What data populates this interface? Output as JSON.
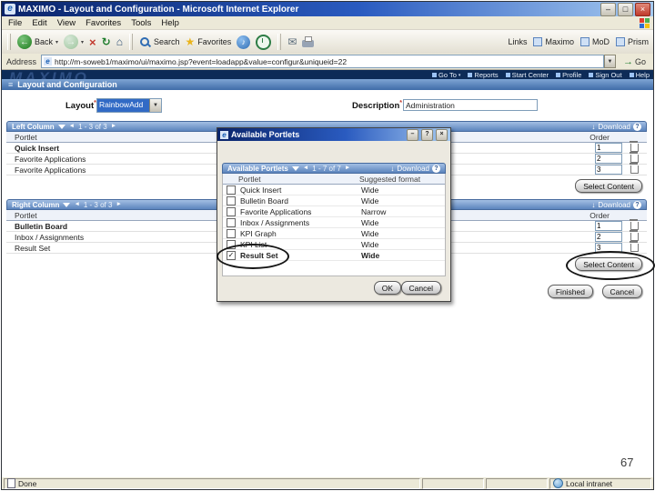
{
  "slide": {
    "number": "67"
  },
  "icons": {
    "ie": "e",
    "minimize": "–",
    "maximize": "□",
    "close": "×",
    "back": "←",
    "forward": "→",
    "stop": "×",
    "refresh": "↻",
    "home": "⌂",
    "favorites_star": "★",
    "media_note": "♪",
    "mail": "✉",
    "dropdown": "▾",
    "select_arrow": "▼",
    "go_arrow": "→",
    "prev": "◄",
    "next": "►",
    "download": "↓",
    "help": "?",
    "menu": "≡"
  },
  "window": {
    "title": "MAXIMO - Layout and Configuration - Microsoft Internet Explorer",
    "menu": [
      "File",
      "Edit",
      "View",
      "Favorites",
      "Tools",
      "Help"
    ],
    "toolbar": {
      "back": "Back",
      "search": "Search",
      "favorites": "Favorites",
      "links": "Links",
      "link_items": [
        "Maximo",
        "MoD",
        "Prism"
      ]
    },
    "address": {
      "label": "Address",
      "url": "http://m-soweb1/maximo/ui/maximo.jsp?event=loadapp&value=configur&uniqueid=22",
      "go": "Go"
    },
    "status": {
      "done": "Done",
      "zone": "Local intranet"
    }
  },
  "app": {
    "watermark": "MAXIMO",
    "nav": [
      "Go To",
      "Reports",
      "Start Center",
      "Profile",
      "Sign Out",
      "Help"
    ],
    "page_title": "Layout and Configuration",
    "form": {
      "layout_label": "Layout",
      "required": "*",
      "layout_value": "RainbowAdd",
      "description_label": "Description",
      "description_value": "Administration"
    },
    "left_column": {
      "title": "Left Column",
      "pager": "1 - 3 of 3",
      "download": "Download",
      "col_name": "Portlet",
      "col_order": "Order",
      "rows": [
        {
          "name": "Quick Insert",
          "order": "1"
        },
        {
          "name": "Favorite Applications",
          "order": "2"
        },
        {
          "name": "Favorite Applications",
          "order": "3"
        }
      ],
      "select_content": "Select Content"
    },
    "right_column": {
      "title": "Right Column",
      "pager": "1 - 3 of 3",
      "download": "Download",
      "col_name": "Portlet",
      "col_order": "Order",
      "rows": [
        {
          "name": "Bulletin Board",
          "order": "1"
        },
        {
          "name": "Inbox / Assignments",
          "order": "2"
        },
        {
          "name": "Result Set",
          "order": "3"
        }
      ],
      "select_content": "Select Content"
    },
    "footer": {
      "finished": "Finished",
      "cancel": "Cancel"
    }
  },
  "dialog": {
    "title": "Available Portlets",
    "section_title": "Available Portlets",
    "pager": "1 - 7 of 7",
    "download": "Download",
    "col_name": "Portlet",
    "col_format": "Suggested format",
    "rows": [
      {
        "name": "Quick Insert",
        "format": "Wide",
        "check": ""
      },
      {
        "name": "Bulletin Board",
        "format": "Wide",
        "check": ""
      },
      {
        "name": "Favorite Applications",
        "format": "Narrow",
        "check": ""
      },
      {
        "name": "Inbox / Assignments",
        "format": "Wide",
        "check": ""
      },
      {
        "name": "KPI Graph",
        "format": "Wide",
        "check": ""
      },
      {
        "name": "KPI List",
        "format": "Wide",
        "check": ""
      },
      {
        "name": "Result Set",
        "format": "Wide",
        "check": "✓"
      }
    ],
    "ok": "OK",
    "cancel": "Cancel"
  }
}
